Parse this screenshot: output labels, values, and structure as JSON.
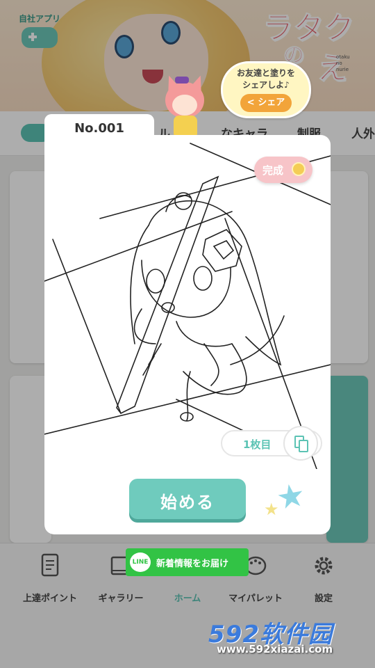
{
  "header": {
    "app_badge_label": "自社アプリ",
    "logo_text": "ラタク",
    "logo_text_2": "の",
    "logo_text_3": "え",
    "logo_sub": "otaku no nurie",
    "share_bubble": {
      "message_line1": "お友達と塗りを",
      "message_line2": "シェアしよ♪",
      "share_button": "シェア"
    }
  },
  "tabs": [
    {
      "label": "ル"
    },
    {
      "label": "なキャラ"
    },
    {
      "label": "制服"
    },
    {
      "label": "人外"
    }
  ],
  "modal": {
    "number_tab": "No.001",
    "status_badge": "完成",
    "sheet_count": "1枚目",
    "start_button": "始める"
  },
  "line_notice": {
    "logo": "LINE",
    "text": "新着情報をお届け"
  },
  "nav": [
    {
      "label": "上達ポイント",
      "icon": "document-icon"
    },
    {
      "label": "ギャラリー",
      "icon": "gallery-icon"
    },
    {
      "label": "ホーム",
      "icon": "home-icon"
    },
    {
      "label": "マイパレット",
      "icon": "palette-icon"
    },
    {
      "label": "設定",
      "icon": "gear-icon"
    }
  ],
  "watermark": {
    "brand": "592软件园",
    "url": "www.592xiazai.com"
  },
  "colors": {
    "accent": "#5cc3b4",
    "badge_pink": "#f7c4c8",
    "line_green": "#32c345",
    "share_orange": "#f2a43a"
  }
}
